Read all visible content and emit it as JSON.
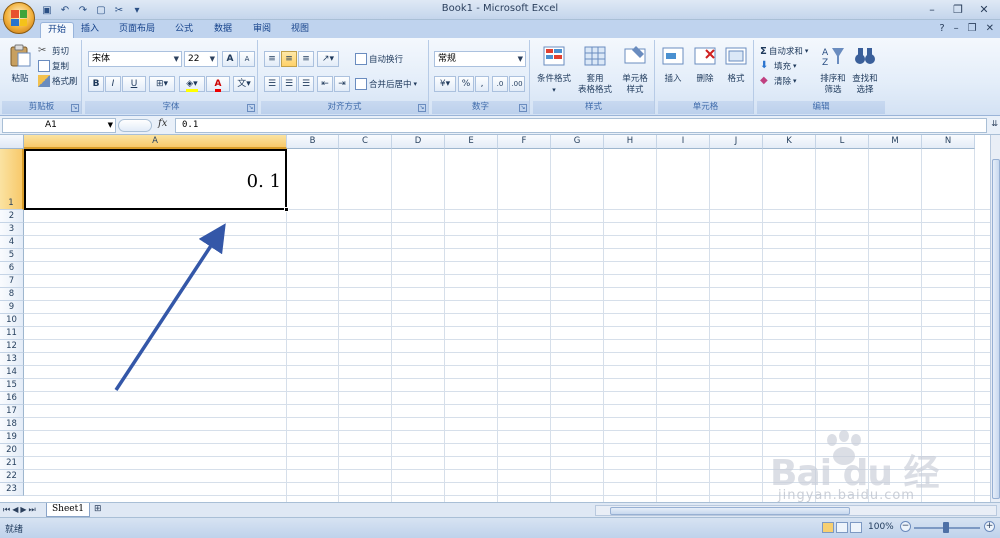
{
  "title": "Book1 - Microsoft Excel",
  "tabs": [
    "开始",
    "插入",
    "页面布局",
    "公式",
    "数据",
    "审阅",
    "视图"
  ],
  "ribbon": {
    "clipboard": {
      "paste": "粘贴",
      "cut": "剪切",
      "copy": "复制",
      "format_painter": "格式刷",
      "label": "剪贴板"
    },
    "font": {
      "name": "宋体",
      "size": "22",
      "bold": "B",
      "italic": "I",
      "underline": "U",
      "grow": "A",
      "shrink": "A",
      "font_color": "A",
      "label": "字体"
    },
    "alignment": {
      "wrap": "自动换行",
      "merge": "合并后居中",
      "label": "对齐方式"
    },
    "number": {
      "format": "常规",
      "percent": "%",
      "comma": ",",
      "label": "数字"
    },
    "styles": {
      "conditional": "条件格式",
      "table_line1": "套用",
      "table_line2": "表格格式",
      "cell_line1": "单元格",
      "cell_line2": "样式",
      "label": "样式"
    },
    "cells": {
      "insert": "插入",
      "delete": "删除",
      "format": "格式",
      "label": "单元格"
    },
    "editing": {
      "autosum": "自动求和",
      "fill": "填充",
      "clear": "清除",
      "sort_line1": "排序和",
      "sort_line2": "筛选",
      "find_line1": "查找和",
      "find_line2": "选择",
      "label": "编辑"
    }
  },
  "formula_bar": {
    "name_box": "A1",
    "fx": "fx",
    "content": "0.1"
  },
  "columns": [
    "A",
    "B",
    "C",
    "D",
    "E",
    "F",
    "G",
    "H",
    "I",
    "J",
    "K",
    "L",
    "M",
    "N"
  ],
  "rows": [
    "1",
    "2",
    "3",
    "4",
    "5",
    "6",
    "7",
    "8",
    "9",
    "10",
    "11",
    "12",
    "13",
    "14",
    "15",
    "16",
    "17",
    "18",
    "19",
    "20",
    "21",
    "22",
    "23"
  ],
  "cell_a1": "0. 1",
  "sheet_tab": "Sheet1",
  "status": {
    "ready": "就绪",
    "zoom": "100%"
  },
  "watermark": {
    "main": "Bai du 经验",
    "sub": "jingyan.baidu.com"
  }
}
